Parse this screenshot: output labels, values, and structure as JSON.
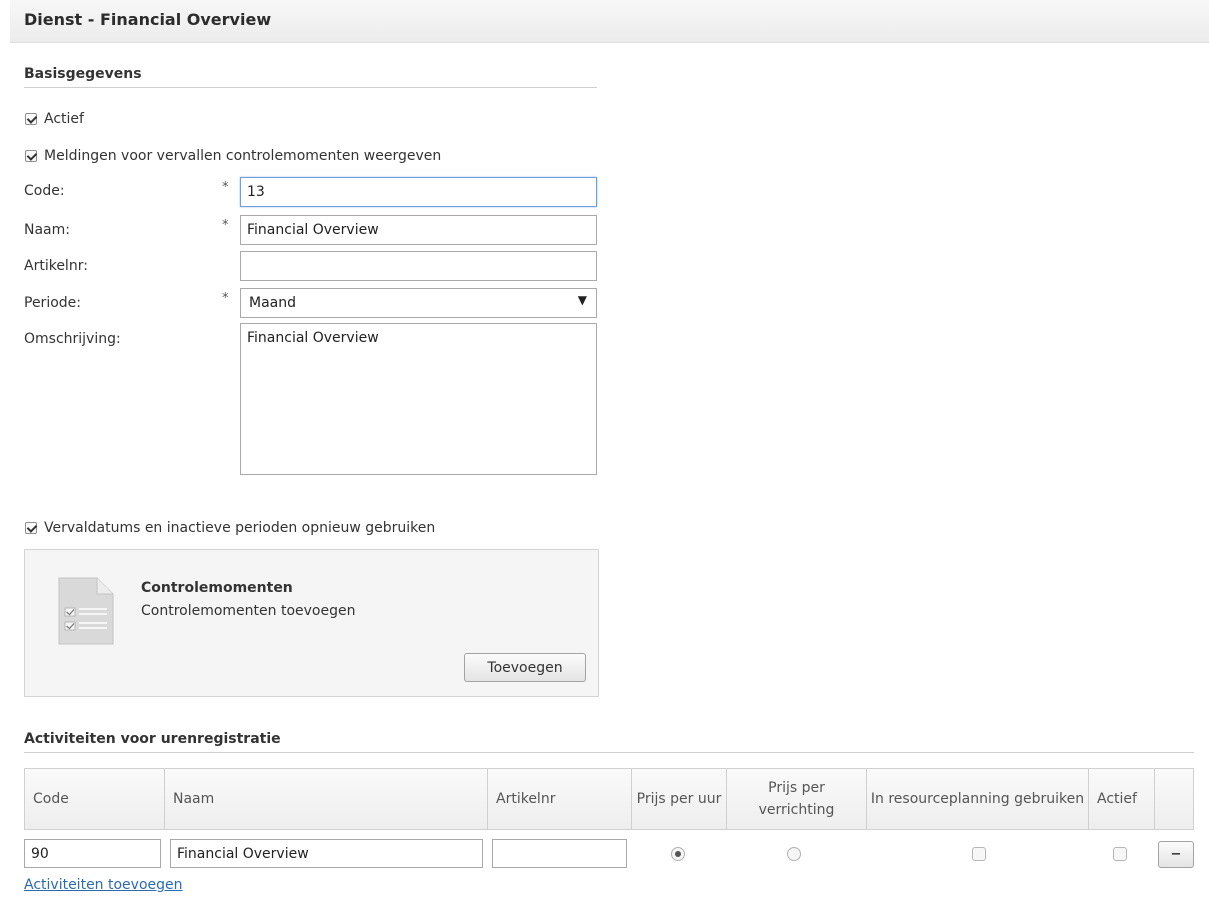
{
  "header": {
    "title": "Dienst - Financial Overview"
  },
  "basic": {
    "section_title": "Basisgegevens",
    "actief_label": "Actief",
    "notify_label": "Meldingen voor vervallen controlemomenten weergeven",
    "code_label": "Code:",
    "code_value": "13",
    "naam_label": "Naam:",
    "naam_value": "Financial Overview",
    "artikelnr_label": "Artikelnr:",
    "artikelnr_value": "",
    "periode_label": "Periode:",
    "periode_value": "Maand",
    "omschrijving_label": "Omschrijving:",
    "omschrijving_value": "Financial Overview",
    "required_mark": "*",
    "reuse_label": "Vervaldatums en inactieve perioden opnieuw gebruiken"
  },
  "controle": {
    "title": "Controlemomenten",
    "subtitle": "Controlemomenten toevoegen",
    "add_button": "Toevoegen"
  },
  "activities": {
    "section_title": "Activiteiten voor urenregistratie",
    "columns": {
      "code": "Code",
      "naam": "Naam",
      "artikelnr": "Artikelnr",
      "prijs_uur": "Prijs per uur",
      "prijs_verrichting": "Prijs per verrichting",
      "resourceplanning": "In resourceplanning gebruiken",
      "actief": "Actief"
    },
    "rows": [
      {
        "code": "90",
        "naam": "Financial Overview",
        "artikelnr": "",
        "remove_label": "−"
      }
    ],
    "add_link": "Activiteiten toevoegen"
  }
}
